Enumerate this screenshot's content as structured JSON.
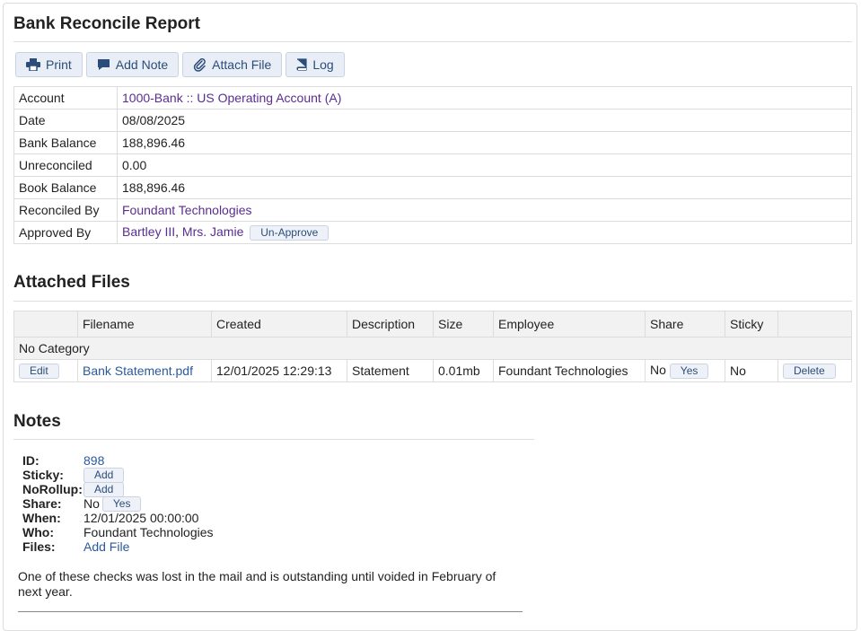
{
  "page": {
    "title": "Bank Reconcile Report"
  },
  "toolbar": [
    {
      "label": "Print",
      "icon": "printer-icon"
    },
    {
      "label": "Add Note",
      "icon": "comment-icon"
    },
    {
      "label": "Attach File",
      "icon": "paperclip-icon"
    },
    {
      "label": "Log",
      "icon": "book-icon"
    }
  ],
  "details": {
    "account": {
      "label": "Account",
      "value": "1000-Bank :: US Operating Account (A)"
    },
    "date": {
      "label": "Date",
      "value": "08/08/2025"
    },
    "bank_balance": {
      "label": "Bank Balance",
      "value": "188,896.46"
    },
    "unreconciled": {
      "label": "Unreconciled",
      "value": "0.00"
    },
    "book_balance": {
      "label": "Book Balance",
      "value": "188,896.46"
    },
    "reconciled_by": {
      "label": "Reconciled By",
      "value": "Foundant Technologies"
    },
    "approved_by": {
      "label": "Approved By",
      "last": "Bartley III",
      "sep": ", ",
      "first": "Mrs. Jamie",
      "button": "Un-Approve"
    }
  },
  "attached": {
    "title": "Attached Files",
    "columns": [
      "",
      "Filename",
      "Created",
      "Description",
      "Size",
      "Employee",
      "Share",
      "Sticky",
      ""
    ],
    "category": "No Category",
    "row": {
      "edit": "Edit",
      "filename": "Bank Statement.pdf",
      "created": "12/01/2025 12:29:13",
      "description": "Statement",
      "size": "0.01mb",
      "employee": "Foundant Technologies",
      "share": "No",
      "share_button": "Yes",
      "sticky": "No",
      "delete": "Delete"
    }
  },
  "notes": {
    "title": "Notes",
    "id_label": "ID:",
    "id": "898",
    "sticky_label": "Sticky:",
    "sticky_button": "Add",
    "norollup_label": "NoRollup:",
    "norollup_button": "Add",
    "share_label": "Share:",
    "share_value": "No",
    "share_button": "Yes",
    "when_label": "When:",
    "when": "12/01/2025 00:00:00",
    "who_label": "Who:",
    "who": "Foundant Technologies",
    "files_label": "Files:",
    "files_link": "Add File",
    "text": "One of these checks was lost in the mail and is outstanding until voided in February of next year."
  },
  "colors": {
    "link_purple": "#5a2d91",
    "link_blue": "#2a5a9b",
    "button_bg": "#e9eef6"
  }
}
